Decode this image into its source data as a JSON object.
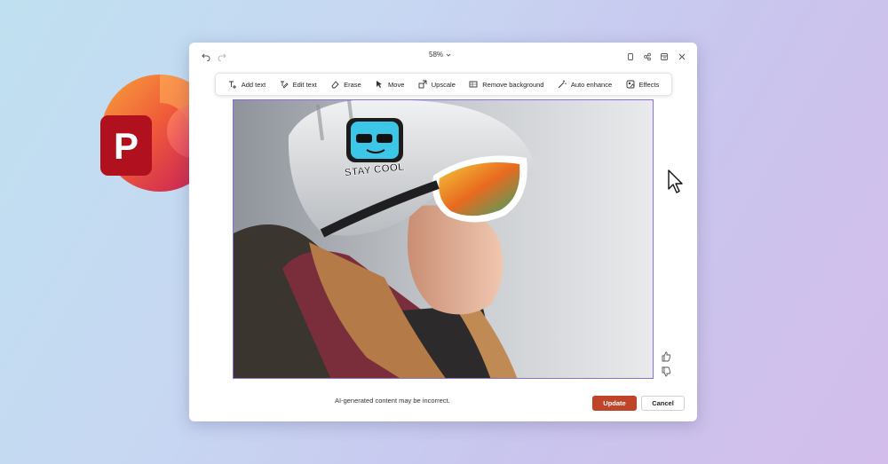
{
  "app": {
    "logo_letter": "P"
  },
  "titlebar": {
    "zoom_label": "58%"
  },
  "toolbar": {
    "items": [
      {
        "label": "Add text",
        "icon": "add-text-icon"
      },
      {
        "label": "Edit text",
        "icon": "edit-text-icon"
      },
      {
        "label": "Erase",
        "icon": "eraser-icon"
      },
      {
        "label": "Move",
        "icon": "move-icon"
      },
      {
        "label": "Upscale",
        "icon": "upscale-icon"
      },
      {
        "label": "Remove background",
        "icon": "remove-background-icon"
      },
      {
        "label": "Auto enhance",
        "icon": "auto-enhance-icon"
      },
      {
        "label": "Effects",
        "icon": "effects-icon"
      }
    ]
  },
  "image": {
    "sticker_text": "STAY COOL"
  },
  "footer": {
    "disclaimer": "AI-generated content may be incorrect.",
    "update_label": "Update",
    "cancel_label": "Cancel"
  },
  "colors": {
    "accent": "#c0442a",
    "selection_border": "#8a6fd0"
  }
}
